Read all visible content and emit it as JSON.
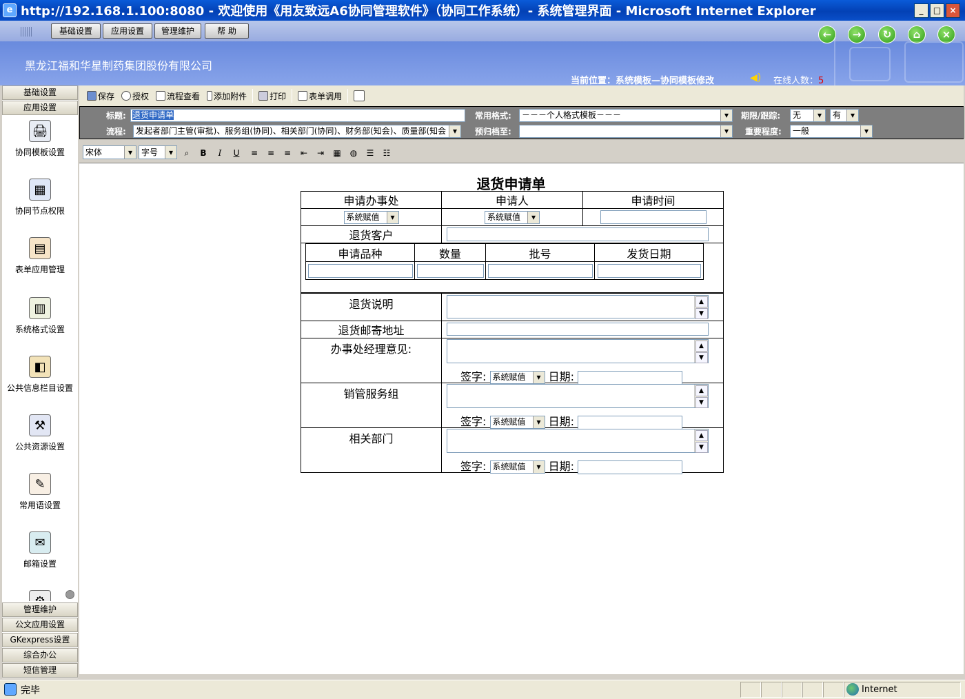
{
  "window": {
    "title": "http://192.168.1.100:8080 - 欢迎使用《用友致远A6协同管理软件》（协同工作系统）- 系统管理界面 - Microsoft Internet Explorer"
  },
  "menu": {
    "items": [
      "基础设置",
      "应用设置",
      "管理维护",
      "帮 助"
    ]
  },
  "header": {
    "company": "黑龙江福和华星制药集团股份有限公司",
    "location": "当前位置：系统模板—协同模板修改",
    "online_label": "在线人数：",
    "online_count": "5"
  },
  "sidebar": {
    "top_sections": [
      "基础设置",
      "应用设置"
    ],
    "items": [
      "协同模板设置",
      "协同节点权限",
      "表单应用管理",
      "系统格式设置",
      "公共信息栏目设置",
      "公共资源设置",
      "常用语设置",
      "邮箱设置"
    ],
    "bottom_sections": [
      "管理维护",
      "公文应用设置",
      "GKexpress设置",
      "综合办公",
      "短信管理"
    ]
  },
  "toolbar": {
    "save": "保存",
    "authorize": "授权",
    "flow_view": "流程查看",
    "add_attachment": "添加附件",
    "print": "打印",
    "form_call": "表单调用"
  },
  "fields": {
    "title_label": "标题:",
    "title_value": "退货申请单",
    "flow_label": "流程:",
    "flow_value": "发起者部门主管(审批)、服务组(协同)、相关部门(协同)、财务部(知会)、质量部(知会",
    "format_label": "常用格式:",
    "format_value": "－－－个人格式模板－－－",
    "archive_label": "预归档至:",
    "archive_value": "",
    "deadline_label": "期限/跟踪:",
    "deadline_value": "无",
    "track_value": "有",
    "importance_label": "重要程度:",
    "importance_value": "一般"
  },
  "editor": {
    "font": "宋体",
    "size": "字号",
    "bold": "B",
    "italic": "I",
    "underline": "U"
  },
  "form": {
    "title": "退货申请单",
    "h_office": "申请办事处",
    "h_applicant": "申请人",
    "h_time": "申请时间",
    "sys_value": "系统赋值",
    "customer": "退货客户",
    "h_product": "申请品种",
    "h_quantity": "数量",
    "h_batch": "批号",
    "h_ship_date": "发货日期",
    "explain": "退货说明",
    "address": "退货邮寄地址",
    "manager_opinion": "办事处经理意见:",
    "sales_group": "销管服务组",
    "related_dept": "相关部门",
    "sign_label": "签字:",
    "date_label": "日期:"
  },
  "status": {
    "text": "完毕",
    "zone": "Internet"
  }
}
